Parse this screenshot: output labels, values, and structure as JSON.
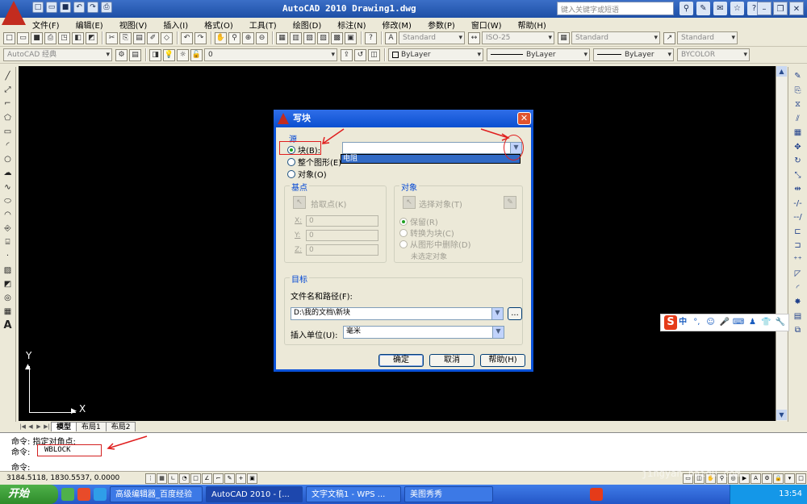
{
  "titlebar": {
    "title": "AutoCAD 2010  Drawing1.dwg",
    "search_placeholder": "键入关键字或短语"
  },
  "menu": [
    "文件(F)",
    "编辑(E)",
    "视图(V)",
    "插入(I)",
    "格式(O)",
    "工具(T)",
    "绘图(D)",
    "标注(N)",
    "修改(M)",
    "参数(P)",
    "窗口(W)",
    "帮助(H)"
  ],
  "toolbar1": {
    "text_style": "Standard",
    "dim_style": "ISO-25",
    "table_style": "Standard",
    "multileader_style": "Standard"
  },
  "toolbar2": {
    "workspace": "AutoCAD 经典",
    "layer": "0",
    "color": "ByLayer",
    "linetype": "ByLayer",
    "lineweight": "ByLayer",
    "plot_style": "BYCOLOR"
  },
  "ucs": {
    "x": "X",
    "y": "Y"
  },
  "layout_tabs": [
    "模型",
    "布局1",
    "布局2"
  ],
  "command": {
    "line1": "命令: 指定对角点:",
    "line2_prompt": "命令:",
    "line2_input": "WBLOCK",
    "line3": "命令:"
  },
  "status": {
    "coords": "3184.5118, 1830.5537, 0.0000"
  },
  "taskbar": {
    "start": "开始",
    "tasks": [
      "高级编辑器_百度经验",
      "AutoCAD 2010 - [...",
      "文字文稿1 - WPS ...",
      "美图秀秀"
    ],
    "time": "13:54"
  },
  "ime": {
    "mode": "中"
  },
  "dialog": {
    "title": "写块",
    "source_group": "源",
    "radio_block": "块(B):",
    "radio_entire": "整个图形(E)",
    "radio_objects": "对象(O)",
    "block_dropdown_value": "",
    "block_dropdown_item": "电阻",
    "basepoint_group": "基点",
    "pick_point": "拾取点(K)",
    "x_label": "X:",
    "y_label": "Y:",
    "z_label": "Z:",
    "x_value": "0",
    "y_value": "0",
    "z_value": "0",
    "objects_group": "对象",
    "select_objects": "选择对象(T)",
    "retain": "保留(R)",
    "convert": "转换为块(C)",
    "delete": "从图形中删除(D)",
    "no_selection": "未选定对象",
    "dest_group": "目标",
    "filename_label": "文件名和路径(F):",
    "filename_value": "D:\\我的文档\\新块",
    "browse": "...",
    "units_label": "插入单位(U):",
    "units_value": "毫米",
    "ok": "确定",
    "cancel": "取消",
    "help": "帮助(H)"
  },
  "watermark": {
    "main": "Baidu经验",
    "sub": "jingyan.baidu.com"
  }
}
